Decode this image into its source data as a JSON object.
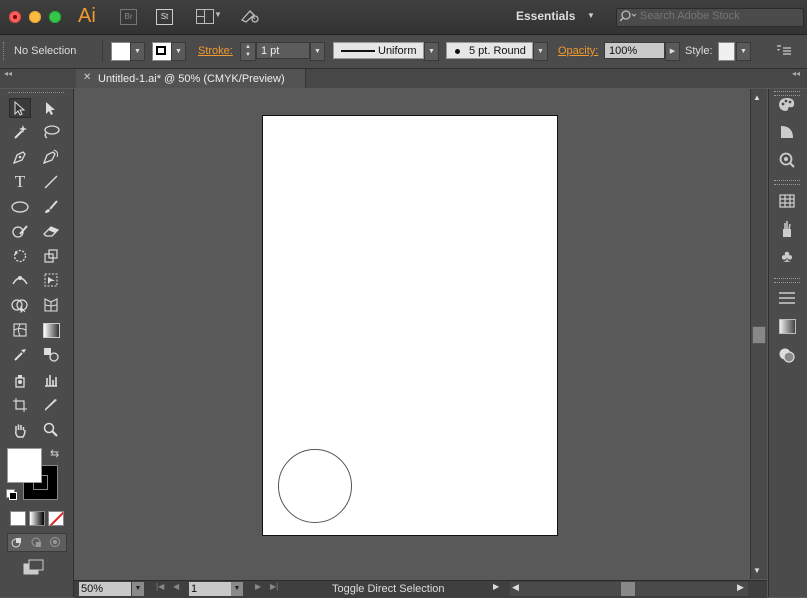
{
  "titlebar": {
    "app_logo": "Ai",
    "bridge_label": "Br",
    "stock_app_label": "St",
    "workspace": "Essentials",
    "search_placeholder": "Search Adobe Stock"
  },
  "control": {
    "selection": "No Selection",
    "stroke_label": "Stroke:",
    "stroke_weight": "1 pt",
    "variable_width": "Uniform",
    "brush": "5 pt. Round",
    "opacity_label": "Opacity:",
    "opacity_value": "100%",
    "style_label": "Style:"
  },
  "document": {
    "tab_title": "Untitled-1.ai* @ 50% (CMYK/Preview)"
  },
  "status": {
    "zoom": "50%",
    "page": "1",
    "message": "Toggle Direct Selection"
  },
  "colors": {
    "accent": "#f29a2e",
    "canvas": "#595959",
    "artboard": "#ffffff"
  },
  "icons": {
    "tools": [
      "selection",
      "direct-selection",
      "magic-wand",
      "lasso",
      "pen",
      "curvature",
      "type",
      "line-segment",
      "ellipse",
      "paintbrush",
      "shaper",
      "eraser",
      "rotate",
      "scale",
      "width",
      "free-transform",
      "shape-builder",
      "perspective-grid",
      "mesh",
      "gradient",
      "eyedropper",
      "blend",
      "symbol-sprayer",
      "column-graph",
      "artboard",
      "slice",
      "hand",
      "zoom"
    ],
    "dock": [
      "color",
      "color-guide",
      "color-themes",
      "swatches",
      "brushes",
      "symbols",
      "stroke",
      "gradient",
      "transparency"
    ]
  }
}
